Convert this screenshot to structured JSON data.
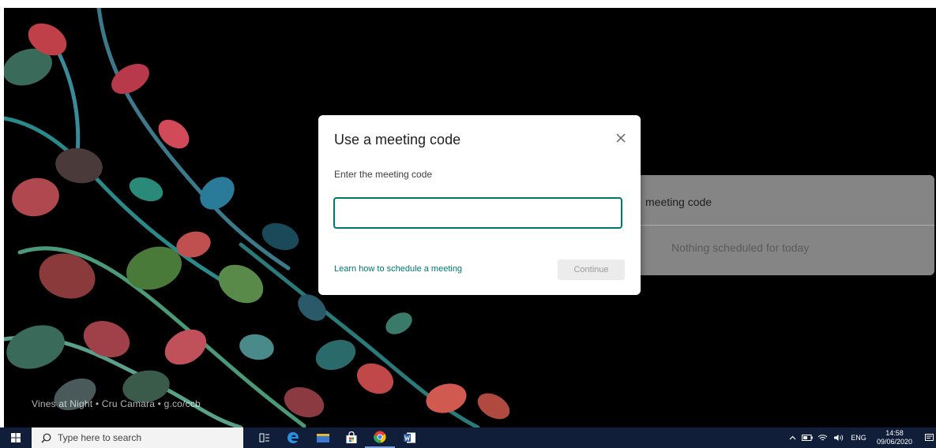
{
  "wallpaper": {
    "attribution": "Vines at Night • Cru Camara • g.co/ccb"
  },
  "background_card": {
    "title": "meeting code",
    "empty_message": "Nothing scheduled for today"
  },
  "dialog": {
    "title": "Use a meeting code",
    "close_icon": "close-icon",
    "field_label": "Enter the meeting code",
    "input_value": "",
    "input_placeholder": "",
    "learn_link": "Learn how to schedule a meeting",
    "continue_label": "Continue",
    "accent_color": "#00796b"
  },
  "taskbar": {
    "search_placeholder": "Type here to search",
    "tray": {
      "language": "ENG",
      "time": "14:58",
      "date": "09/06/2020"
    },
    "colors": {
      "background": "#101e3a"
    }
  }
}
